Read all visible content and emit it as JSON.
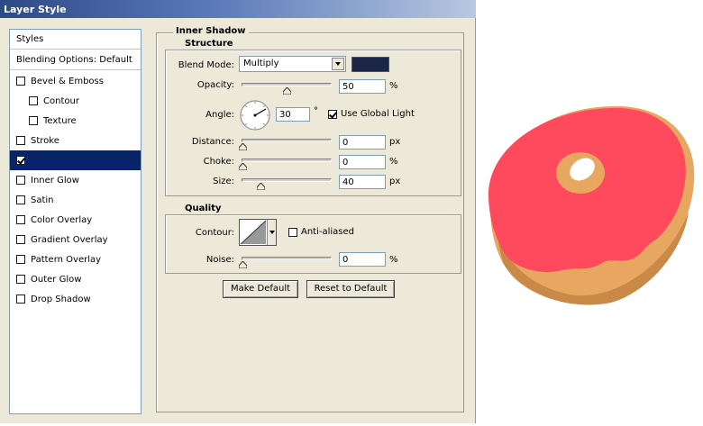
{
  "window": {
    "title": "Layer Style"
  },
  "sidebar": {
    "styles_label": "Styles",
    "blending_label": "Blending Options: Default",
    "items": [
      {
        "label": "Bevel & Emboss",
        "checked": false
      },
      {
        "label": "Contour",
        "checked": false
      },
      {
        "label": "Texture",
        "checked": false
      },
      {
        "label": "Stroke",
        "checked": false
      },
      {
        "label": "",
        "checked": true
      },
      {
        "label": "Inner Glow",
        "checked": false
      },
      {
        "label": "Satin",
        "checked": false
      },
      {
        "label": "Color Overlay",
        "checked": false
      },
      {
        "label": "Gradient Overlay",
        "checked": false
      },
      {
        "label": "Pattern Overlay",
        "checked": false
      },
      {
        "label": "Outer Glow",
        "checked": false
      },
      {
        "label": "Drop Shadow",
        "checked": false
      }
    ]
  },
  "panel": {
    "title": "Inner Shadow",
    "structure": {
      "legend": "Structure",
      "blend_mode_label": "Blend Mode:",
      "blend_mode_value": "Multiply",
      "color_swatch": "#1a2548",
      "opacity_label": "Opacity:",
      "opacity_value": "50",
      "opacity_unit": "%",
      "angle_label": "Angle:",
      "angle_value": "30",
      "angle_unit": "°",
      "use_global_light_label": "Use Global Light",
      "use_global_light_checked": true,
      "distance_label": "Distance:",
      "distance_value": "0",
      "distance_unit": "px",
      "choke_label": "Choke:",
      "choke_value": "0",
      "choke_unit": "%",
      "size_label": "Size:",
      "size_value": "40",
      "size_unit": "px"
    },
    "quality": {
      "legend": "Quality",
      "contour_label": "Contour:",
      "anti_aliased_label": "Anti-aliased",
      "anti_aliased_checked": false,
      "noise_label": "Noise:",
      "noise_value": "0",
      "noise_unit": "%"
    },
    "buttons": {
      "make_default": "Make Default",
      "reset_to_default": "Reset to Default"
    }
  },
  "preview": {
    "icing_color": "#ff4a5d",
    "dough_color": "#e8a760",
    "dough_shadow_color": "#c98a48"
  }
}
